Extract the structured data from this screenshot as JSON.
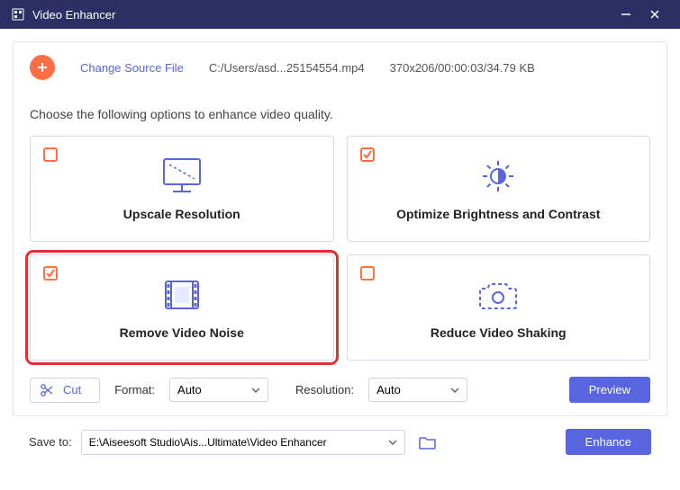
{
  "titlebar": {
    "title": "Video Enhancer"
  },
  "header": {
    "change_source": "Change Source File",
    "file_path": "C:/Users/asd...25154554.mp4",
    "file_info": "370x206/00:00:03/34.79 KB"
  },
  "instruction": "Choose the following options to enhance video quality.",
  "options": [
    {
      "label": "Upscale Resolution",
      "checked": false,
      "highlighted": false,
      "icon": "monitor"
    },
    {
      "label": "Optimize Brightness and Contrast",
      "checked": true,
      "highlighted": false,
      "icon": "brightness"
    },
    {
      "label": "Remove Video Noise",
      "checked": true,
      "highlighted": true,
      "icon": "filmstrip"
    },
    {
      "label": "Reduce Video Shaking",
      "checked": false,
      "highlighted": false,
      "icon": "camera"
    }
  ],
  "controls": {
    "cut": "Cut",
    "format_label": "Format:",
    "format_value": "Auto",
    "resolution_label": "Resolution:",
    "resolution_value": "Auto",
    "preview": "Preview"
  },
  "footer": {
    "save_label": "Save to:",
    "save_path": "E:\\Aiseesoft Studio\\Ais...Ultimate\\Video Enhancer",
    "enhance": "Enhance"
  },
  "colors": {
    "accent": "#5865df",
    "orange": "#fe6f43"
  }
}
